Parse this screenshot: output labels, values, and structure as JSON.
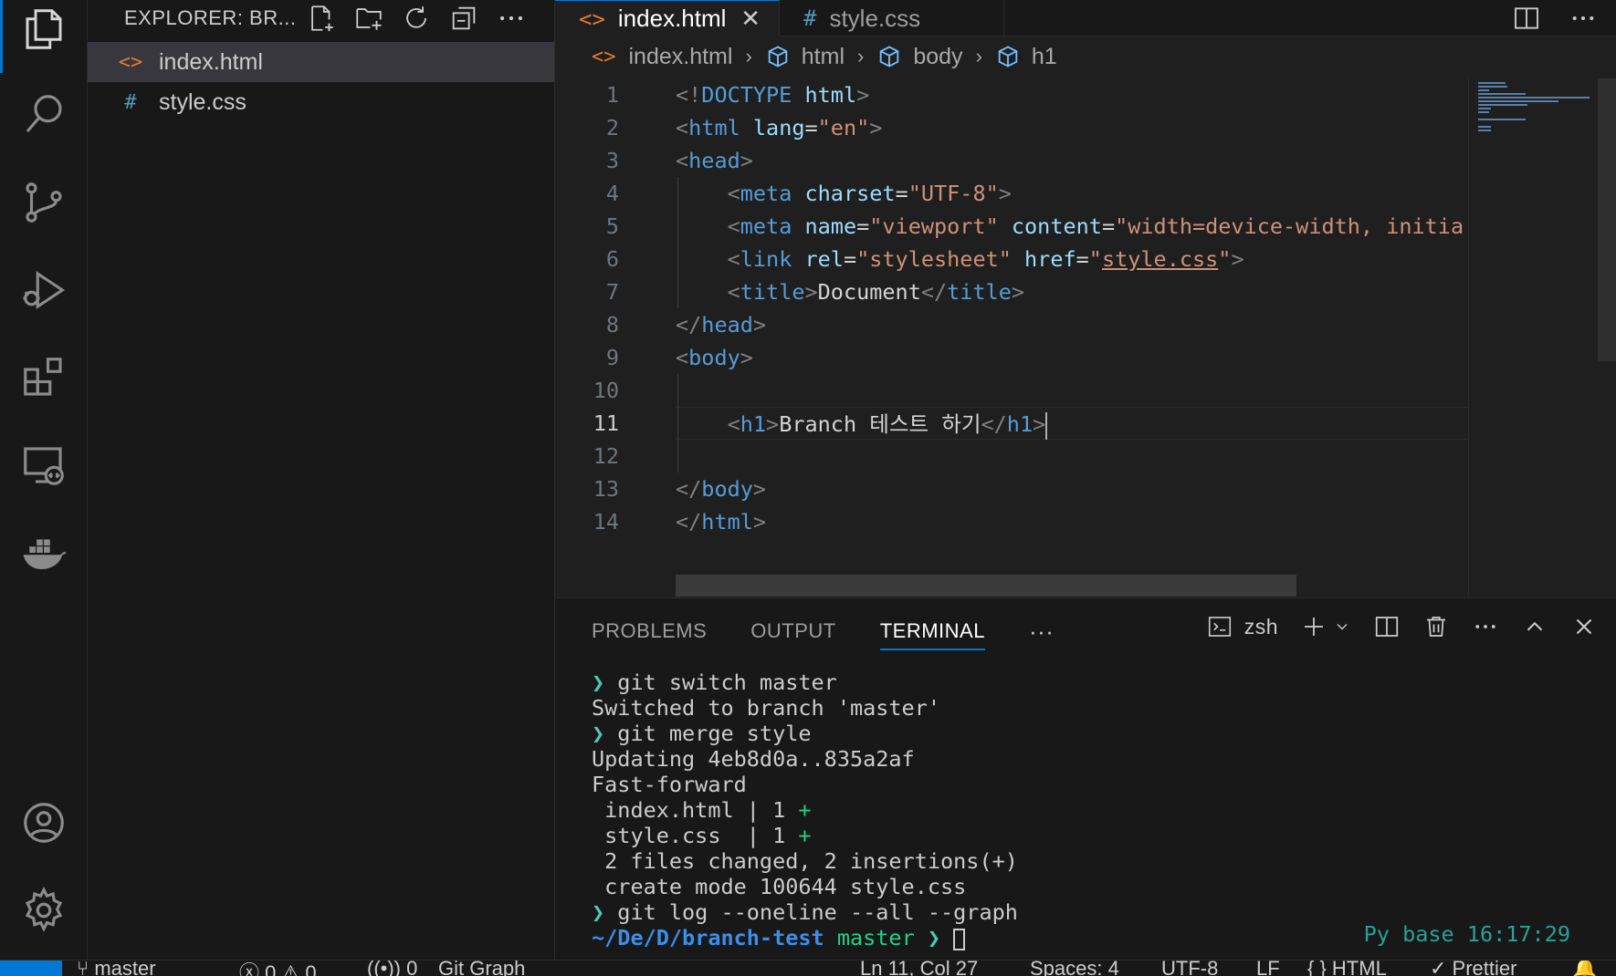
{
  "sidebar": {
    "title": "EXPLORER: BR...",
    "files": [
      {
        "name": "index.html",
        "icon": "<>"
      },
      {
        "name": "style.css",
        "icon": "#"
      }
    ]
  },
  "tabs": [
    {
      "label": "index.html",
      "icon": "<>"
    },
    {
      "label": "style.css",
      "icon": "#"
    }
  ],
  "breadcrumb": {
    "file": "index.html",
    "items": [
      "html",
      "body",
      "h1"
    ]
  },
  "editor": {
    "current_line": 11,
    "lines": [
      {
        "n": "1",
        "parts": [
          [
            "b",
            "<!"
          ],
          [
            "t",
            "DOCTYPE"
          ],
          [
            "x",
            " "
          ],
          [
            "a",
            "html"
          ],
          [
            "b",
            ">"
          ]
        ]
      },
      {
        "n": "2",
        "parts": [
          [
            "b",
            "<"
          ],
          [
            "t",
            "html"
          ],
          [
            "x",
            " "
          ],
          [
            "a",
            "lang"
          ],
          [
            "x",
            "="
          ],
          [
            "s",
            "\"en\""
          ],
          [
            "b",
            ">"
          ]
        ]
      },
      {
        "n": "3",
        "parts": [
          [
            "b",
            "<"
          ],
          [
            "t",
            "head"
          ],
          [
            "b",
            ">"
          ]
        ]
      },
      {
        "n": "4",
        "parts": [
          [
            "x",
            "    "
          ],
          [
            "b",
            "<"
          ],
          [
            "t",
            "meta"
          ],
          [
            "x",
            " "
          ],
          [
            "a",
            "charset"
          ],
          [
            "x",
            "="
          ],
          [
            "s",
            "\"UTF-8\""
          ],
          [
            "b",
            ">"
          ]
        ]
      },
      {
        "n": "5",
        "parts": [
          [
            "x",
            "    "
          ],
          [
            "b",
            "<"
          ],
          [
            "t",
            "meta"
          ],
          [
            "x",
            " "
          ],
          [
            "a",
            "name"
          ],
          [
            "x",
            "="
          ],
          [
            "s",
            "\"viewport\""
          ],
          [
            "x",
            " "
          ],
          [
            "a",
            "content"
          ],
          [
            "x",
            "="
          ],
          [
            "s",
            "\"width=device-width, initia"
          ]
        ]
      },
      {
        "n": "6",
        "parts": [
          [
            "x",
            "    "
          ],
          [
            "b",
            "<"
          ],
          [
            "t",
            "link"
          ],
          [
            "x",
            " "
          ],
          [
            "a",
            "rel"
          ],
          [
            "x",
            "="
          ],
          [
            "s",
            "\"stylesheet\""
          ],
          [
            "x",
            " "
          ],
          [
            "a",
            "href"
          ],
          [
            "x",
            "="
          ],
          [
            "s",
            "\""
          ],
          [
            "u",
            "style.css"
          ],
          [
            "s",
            "\""
          ],
          [
            "b",
            ">"
          ]
        ]
      },
      {
        "n": "7",
        "parts": [
          [
            "x",
            "    "
          ],
          [
            "b",
            "<"
          ],
          [
            "t",
            "title"
          ],
          [
            "b",
            ">"
          ],
          [
            "x",
            "Document"
          ],
          [
            "b",
            "</"
          ],
          [
            "t",
            "title"
          ],
          [
            "b",
            ">"
          ]
        ]
      },
      {
        "n": "8",
        "parts": [
          [
            "b",
            "</"
          ],
          [
            "t",
            "head"
          ],
          [
            "b",
            ">"
          ]
        ]
      },
      {
        "n": "9",
        "parts": [
          [
            "b",
            "<"
          ],
          [
            "t",
            "body"
          ],
          [
            "b",
            ">"
          ]
        ]
      },
      {
        "n": "10",
        "parts": []
      },
      {
        "n": "11",
        "parts": [
          [
            "x",
            "    "
          ],
          [
            "b",
            "<"
          ],
          [
            "t",
            "h1"
          ],
          [
            "b",
            ">"
          ],
          [
            "x",
            "Branch 테스트 하기"
          ],
          [
            "b",
            "</"
          ],
          [
            "t",
            "h1"
          ],
          [
            "b",
            ">"
          ]
        ]
      },
      {
        "n": "12",
        "parts": []
      },
      {
        "n": "13",
        "parts": [
          [
            "b",
            "</"
          ],
          [
            "t",
            "body"
          ],
          [
            "b",
            ">"
          ]
        ]
      },
      {
        "n": "14",
        "parts": [
          [
            "b",
            "</"
          ],
          [
            "t",
            "html"
          ],
          [
            "b",
            ">"
          ]
        ]
      }
    ]
  },
  "panel": {
    "tabs": [
      "PROBLEMS",
      "OUTPUT",
      "TERMINAL"
    ],
    "active_tab": "TERMINAL",
    "shell": "zsh"
  },
  "terminal": {
    "lines": [
      {
        "prompt": true,
        "text": "git switch master"
      },
      {
        "prompt": false,
        "text": "Switched to branch 'master'"
      },
      {
        "prompt": true,
        "text": "git merge style"
      },
      {
        "prompt": false,
        "text": "Updating 4eb8d0a..835a2af"
      },
      {
        "prompt": false,
        "text": "Fast-forward"
      },
      {
        "prompt": false,
        "text": " index.html | 1 ",
        "plus": "+"
      },
      {
        "prompt": false,
        "text": " style.css  | 1 ",
        "plus": "+"
      },
      {
        "prompt": false,
        "text": " 2 files changed, 2 insertions(+)"
      },
      {
        "prompt": false,
        "text": " create mode 100644 style.css"
      },
      {
        "prompt": true,
        "text": "git log --oneline --all --graph"
      }
    ],
    "cwd_prefix": "~/De/D/",
    "cwd_dir": "branch-test",
    "branch": "master",
    "right_prompt": "Py base 16:17:29"
  },
  "statusbar": {
    "branch": "master",
    "errors": "0",
    "warnings": "0",
    "ports": "0",
    "git_graph": "Git Graph",
    "position": "Ln 11, Col 27",
    "spaces": "Spaces: 4",
    "encoding": "UTF-8",
    "eol": "LF",
    "language": "HTML",
    "formatter": "Prettier"
  },
  "colors": {
    "accent": "#0078d4",
    "tag": "#569cd6",
    "attribute": "#9cdcfe",
    "string": "#ce9178",
    "html_icon": "#e37933",
    "css_icon": "#519aba"
  }
}
